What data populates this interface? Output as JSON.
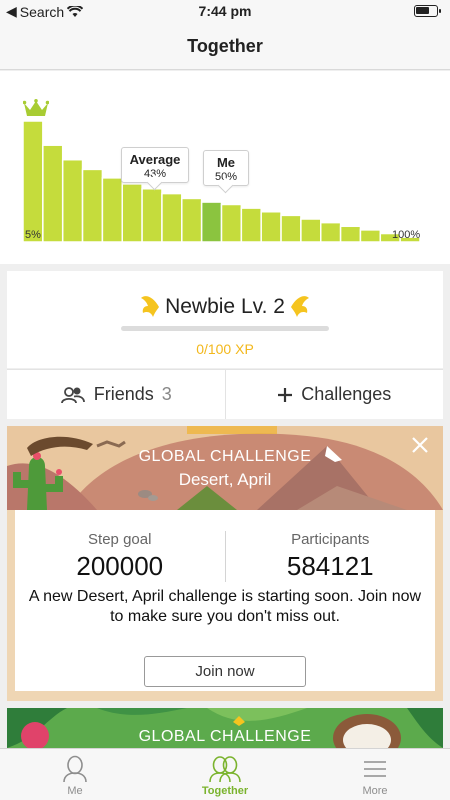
{
  "status_bar": {
    "back_label": "Search",
    "time": "7:44 pm",
    "battery_level": 0.7
  },
  "nav": {
    "title": "Together"
  },
  "chart_data": {
    "type": "bar",
    "bar_count": 20,
    "values": [
      100,
      80,
      68,
      60,
      53,
      48,
      44,
      40,
      36,
      33,
      31,
      28,
      25,
      22,
      19,
      16,
      13,
      10,
      7,
      4
    ],
    "highlight_index": 9,
    "x_start_label": "5%",
    "x_end_label": "100%",
    "average": {
      "label": "Average",
      "value": "43%"
    },
    "me": {
      "label": "Me",
      "value": "50%"
    },
    "colors": {
      "bar": "#c5dc3c",
      "highlight": "#8bc43f",
      "curve": "#b8d62a",
      "crown": "#a8cc33"
    }
  },
  "level": {
    "name": "Newbie Lv. 2",
    "xp": "0/100 XP",
    "progress": 0
  },
  "actions": {
    "friends": {
      "label": "Friends",
      "count": "3"
    },
    "challenges": {
      "label": "Challenges"
    }
  },
  "challenge": {
    "title": "GLOBAL CHALLENGE",
    "subtitle": "Desert, April",
    "step_goal_label": "Step goal",
    "step_goal_value": "200000",
    "participants_label": "Participants",
    "participants_value": "584121",
    "description": "A new Desert, April challenge is starting soon. Join now to make sure you don't miss out.",
    "join_label": "Join now"
  },
  "challenge2": {
    "title": "GLOBAL CHALLENGE"
  },
  "tabs": [
    {
      "label": "Me",
      "active": false
    },
    {
      "label": "Together",
      "active": true
    },
    {
      "label": "More",
      "active": false
    }
  ],
  "colors": {
    "accent": "#7ab32d",
    "xp": "#f3b81c"
  }
}
